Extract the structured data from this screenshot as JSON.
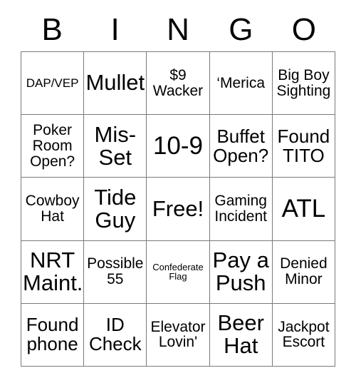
{
  "card": {
    "header_letters": [
      "B",
      "I",
      "N",
      "G",
      "O"
    ],
    "free_space_label": "Free!",
    "border_color": "#7a7a7a",
    "text_color": "#000000",
    "background_color": "#ffffff",
    "rows": [
      [
        {
          "text": "DAP/VEP",
          "size": "sm"
        },
        {
          "text": "Mullet",
          "size": "xl"
        },
        {
          "text": "$9\nWacker",
          "size": "md"
        },
        {
          "text": "‘Merica",
          "size": "md"
        },
        {
          "text": "Big Boy\nSighting",
          "size": "md"
        }
      ],
      [
        {
          "text": "Poker\nRoom\nOpen?",
          "size": "md"
        },
        {
          "text": "Mis-\nSet",
          "size": "xl"
        },
        {
          "text": "10-9",
          "size": "xxl"
        },
        {
          "text": "Buffet\nOpen?",
          "size": "lg"
        },
        {
          "text": "Found\nTITO",
          "size": "lg"
        }
      ],
      [
        {
          "text": "Cowboy\nHat",
          "size": "md"
        },
        {
          "text": "Tide\nGuy",
          "size": "xl"
        },
        {
          "text": "Free!",
          "size": "xl"
        },
        {
          "text": "Gaming\nIncident",
          "size": "md"
        },
        {
          "text": "ATL",
          "size": "xxl"
        }
      ],
      [
        {
          "text": "NRT\nMaint.",
          "size": "xl"
        },
        {
          "text": "Possible\n55",
          "size": "md"
        },
        {
          "text": "Confederate\nFlag",
          "size": "xs"
        },
        {
          "text": "Pay a\nPush",
          "size": "xl"
        },
        {
          "text": "Denied\nMinor",
          "size": "md"
        }
      ],
      [
        {
          "text": "Found\nphone",
          "size": "lg"
        },
        {
          "text": "ID\nCheck",
          "size": "lg"
        },
        {
          "text": "Elevator\nLovin'",
          "size": "md"
        },
        {
          "text": "Beer\nHat",
          "size": "xl"
        },
        {
          "text": "Jackpot\nEscort",
          "size": "md"
        }
      ]
    ]
  }
}
